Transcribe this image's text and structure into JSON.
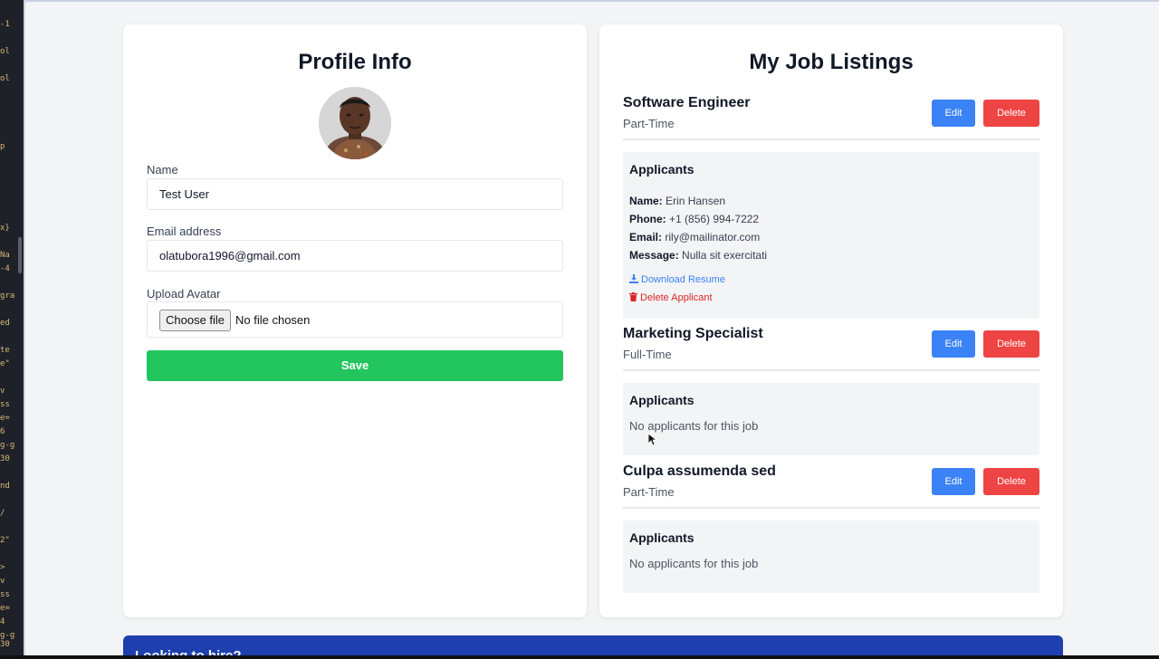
{
  "profile": {
    "title": "Profile Info",
    "name_label": "Name",
    "name_value": "Test User",
    "email_label": "Email address",
    "email_value": "olatubora1996@gmail.com",
    "avatar_label": "Upload Avatar",
    "choose_file": "Choose file",
    "no_file": "No file chosen",
    "save": "Save"
  },
  "jobs": {
    "title": "My Job Listings",
    "edit": "Edit",
    "delete": "Delete",
    "applicants_heading": "Applicants",
    "no_applicants": "No applicants for this job",
    "items": [
      {
        "title": "Software Engineer",
        "type": "Part-Time",
        "applicant": {
          "name_label": "Name:",
          "name": "Erin Hansen",
          "phone_label": "Phone:",
          "phone": "+1 (856) 994-7222",
          "email_label": "Email:",
          "email": "rily@mailinator.com",
          "message_label": "Message:",
          "message": "Nulla sit exercitati",
          "download": "Download Resume",
          "delete": "Delete Applicant"
        }
      },
      {
        "title": "Marketing Specialist",
        "type": "Full-Time"
      },
      {
        "title": "Culpa assumenda sed",
        "type": "Part-Time"
      }
    ]
  },
  "footer": {
    "banner_text": "Looking to hire?"
  },
  "editor_fragments": [
    "-1",
    "ol",
    "ol",
    "p",
    "x}",
    "Na",
    "-4",
    "gra",
    "ed",
    "te",
    "e\"",
    "v",
    "ss",
    "e=",
    "6",
    "g-g",
    "30",
    "nd",
    "/",
    "2\"",
    ">",
    "v",
    "ss",
    "e=",
    "4",
    "g-g",
    "30"
  ],
  "colors": {
    "save": "#22c55e",
    "edit": "#3b82f6",
    "delete": "#ef4444",
    "banner": "#1e40af"
  }
}
